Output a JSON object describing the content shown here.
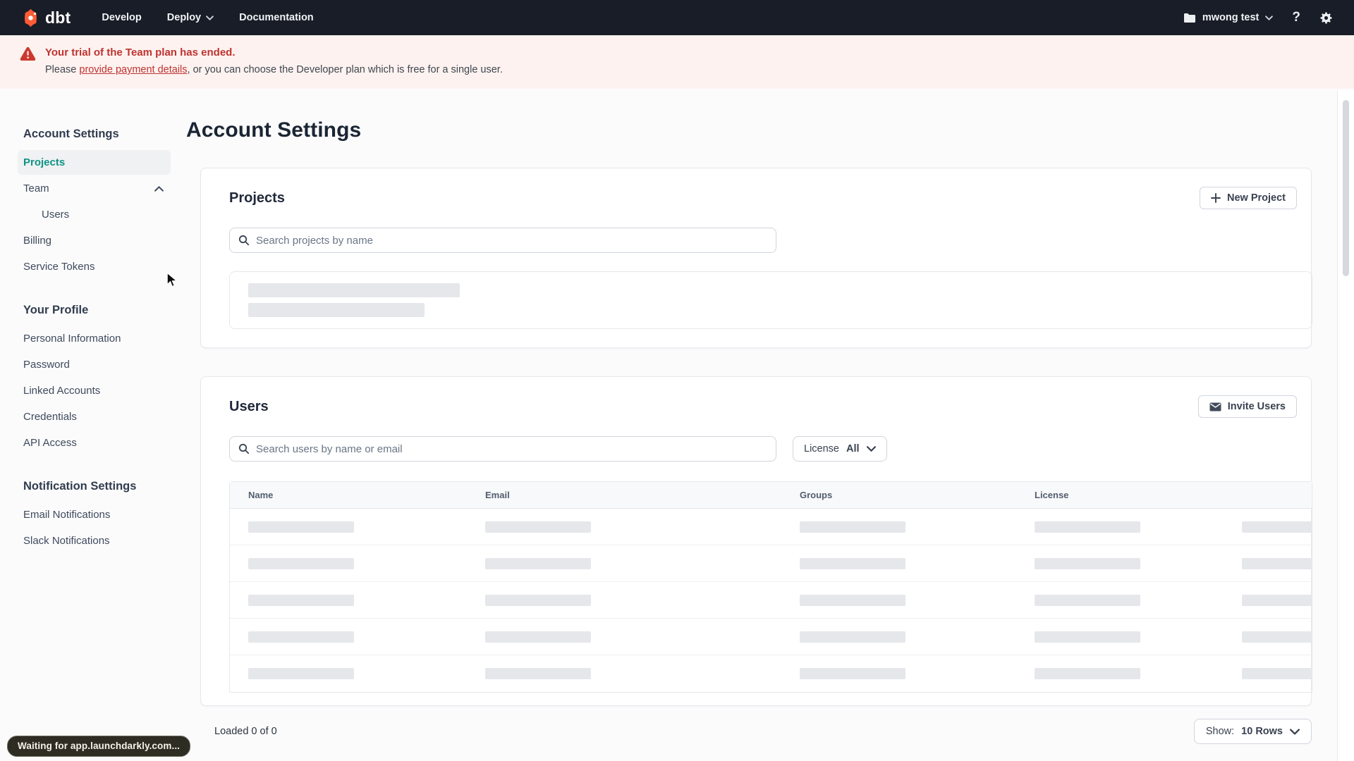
{
  "nav": {
    "brand": "dbt",
    "develop_label": "Develop",
    "deploy_label": "Deploy",
    "documentation_label": "Documentation",
    "account_name": "mwong test"
  },
  "banner": {
    "title": "Your trial of the Team plan has ended.",
    "body_prefix": "Please ",
    "link_text": "provide payment details",
    "body_suffix": ", or you can choose the Developer plan which is free for a single user."
  },
  "sidebar": {
    "sections": [
      {
        "heading": "Account Settings",
        "items": [
          {
            "label": "Projects"
          },
          {
            "label": "Team"
          },
          {
            "label": "Users"
          },
          {
            "label": "Billing"
          },
          {
            "label": "Service Tokens"
          }
        ]
      },
      {
        "heading": "Your Profile",
        "items": [
          {
            "label": "Personal Information"
          },
          {
            "label": "Password"
          },
          {
            "label": "Linked Accounts"
          },
          {
            "label": "Credentials"
          },
          {
            "label": "API Access"
          }
        ]
      },
      {
        "heading": "Notification Settings",
        "items": [
          {
            "label": "Email Notifications"
          },
          {
            "label": "Slack Notifications"
          }
        ]
      }
    ]
  },
  "page": {
    "title": "Account Settings"
  },
  "projects_card": {
    "title": "Projects",
    "new_project_button": "New Project",
    "search_placeholder": "Search projects by name"
  },
  "users_card": {
    "title": "Users",
    "invite_button": "Invite Users",
    "search_placeholder": "Search users by name or email",
    "license_filter_label": "License",
    "license_filter_value": "All",
    "table": {
      "columns": [
        "Name",
        "Email",
        "Groups",
        "License"
      ]
    },
    "footer": {
      "loaded_text": "Loaded 0 of 0",
      "show_label": "Show:",
      "rows_value": "10 Rows"
    }
  },
  "status_bubble": "Waiting for app.launchdarkly.com...",
  "icons": [
    "dbt-logo",
    "caret-down-icon",
    "folder-icon",
    "question-mark-icon",
    "gear-icon",
    "warning-triangle-icon",
    "search-icon",
    "plus-icon",
    "envelope-icon",
    "chevron-up-icon",
    "chevron-down-icon",
    "mouse-cursor"
  ],
  "colors": {
    "nav_bg": "#181d27",
    "brand_orange": "#ff5c35",
    "accent_teal": "#0e9384",
    "alert_red": "#bf3330",
    "banner_bg": "#fdf2f0"
  }
}
